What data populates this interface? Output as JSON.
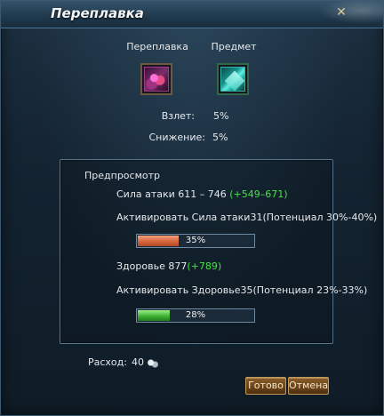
{
  "window": {
    "title": "Переплавка",
    "close_symbol": "✕"
  },
  "slots": {
    "refine_label": "Переплавка",
    "item_label": "Предмет",
    "refine_icon": "refine-item-icon",
    "item_icon": "crystal-icon"
  },
  "stats": {
    "rise_label": "Взлет:",
    "rise_value": "5%",
    "drop_label": "Снижение:",
    "drop_value": "5%"
  },
  "preview": {
    "title": "Предпросмотр",
    "attack_label": "Сила атаки 611 – 746",
    "attack_bonus": "(+549–671)",
    "attack_activate": "Активировать Сила атаки31(Потенциал 30%-40%)",
    "attack_percent": "35%",
    "attack_fill": 0.35,
    "health_label": "Здоровье 877",
    "health_bonus": "(+789)",
    "health_activate": "Активировать Здоровье35(Потенциал 23%-33%)",
    "health_percent": "28%",
    "health_fill": 0.28
  },
  "cost": {
    "label": "Расход:",
    "value": "40",
    "icon": "silver-coin-icon"
  },
  "buttons": {
    "ok_label": "Готово",
    "cancel_label": "Отмена"
  },
  "colors": {
    "bonus_green": "#3ee83e",
    "attack_bar": "#d8663e",
    "health_bar": "#3fb232"
  }
}
